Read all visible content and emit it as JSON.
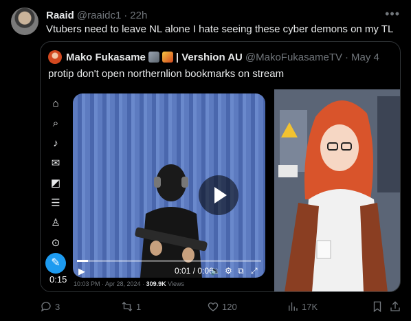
{
  "tweet": {
    "author_name": "Raaid",
    "handle": "@raaidc1",
    "separator": "·",
    "time": "22h",
    "text": "Vtubers need to leave NL alone I hate seeing these cyber demons on my TL"
  },
  "quote": {
    "author_name": "Mako Fukasame",
    "author_suffix": "| Vershion AU",
    "handle": "@MakoFukasameTV",
    "separator": "·",
    "date": "May 4",
    "text": "protip don't open northernlion bookmarks on stream"
  },
  "media": {
    "duration": "0:15",
    "time_readout": "0:01 / 0:06",
    "progress": 0.06,
    "meta_date": "10:03 PM · Apr 28, 2024 ·",
    "meta_views": "309.9K",
    "meta_views_label": "Views"
  },
  "actions": {
    "replies": "3",
    "reposts": "1",
    "likes": "120",
    "views": "17K"
  },
  "colors": {
    "background": "#000000",
    "text": "#e7e9ea",
    "muted": "#71767b",
    "accent": "#1d9bf0",
    "border": "#2f3336"
  }
}
